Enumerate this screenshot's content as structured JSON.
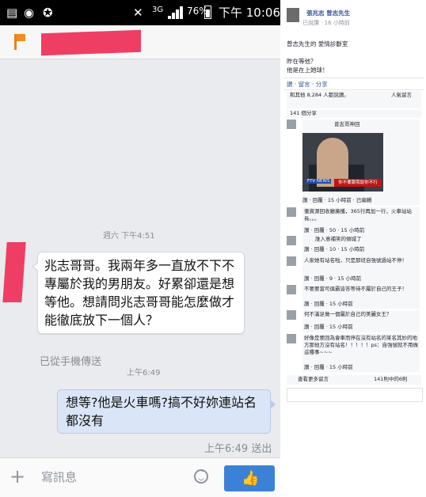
{
  "status_bar": {
    "network": "3G",
    "battery": "76%",
    "time": "下午 10:06"
  },
  "chat": {
    "timestamp_1": "週六 下午4:51",
    "incoming_message": "兆志哥哥。我兩年多一直放不下不專屬於我的男朋友。好累卻還是想等他。想請問兆志哥哥能怎麼做才能徹底放下一個人？",
    "sent_from": "已從手機傳送",
    "timestamp_2": "上午6:49",
    "outgoing_message": "想等?他是火車嗎?搞不好妳連站名都沒有",
    "sent_status": "上午6:49 送出",
    "composer_placeholder": "寫訊息"
  },
  "post": {
    "author": "張兆志 曾志先生",
    "meta": "已說讚 · 16 小時前",
    "text_1": "曾志先生的 愛情診斷室",
    "text_2": "昨在等他？",
    "text_3": "他是在上她球！",
    "actions": "讚 · 留言 · 分享",
    "likes": "和其他 8,284 人都說讚。",
    "top_comments": "人氣留言",
    "shares": "141 個分享",
    "comment_1_name": "曾志哥神回",
    "video_channel": "FTV NEWS",
    "video_caption": "你不要跟我說你不行",
    "comment_1_meta": "讚 · 回覆 · 15 小時前 · 已編輯",
    "comment_2": "徹資源回收廳廣播，365行再加一行，火車站站長。。。",
    "comment_2_meta": "讚 · 回覆 · 50 · 15 小時前",
    "comment_3": "誰入意補笑的傾城了",
    "comment_3_meta": "讚 · 回覆 · 10 · 15 小時前",
    "comment_4": "人家她有站名啦，只是那班自強號過站不停！",
    "comment_4_meta": "讚 · 回覆 · 9 · 15 小時前",
    "comment_5": "不要要當可俱霸皆答等待不屬於自己的王子！",
    "comment_5_meta": "讚 · 回覆 · 15 小時前",
    "comment_6": "何不滿足做一個屬於自己的美麗女王？",
    "comment_6_meta": "讚 · 回覆 · 15 小時前",
    "comment_7": "好像是要回為會車而停在沒有站名的某名其妙的地方那他方沒有站名！！！！！ps：自強號就不用做這種事~~~",
    "comment_7_meta": "讚 · 回覆 · 15 小時前",
    "more_comments": "查看更多留言",
    "comment_count": "141則中的6則"
  }
}
